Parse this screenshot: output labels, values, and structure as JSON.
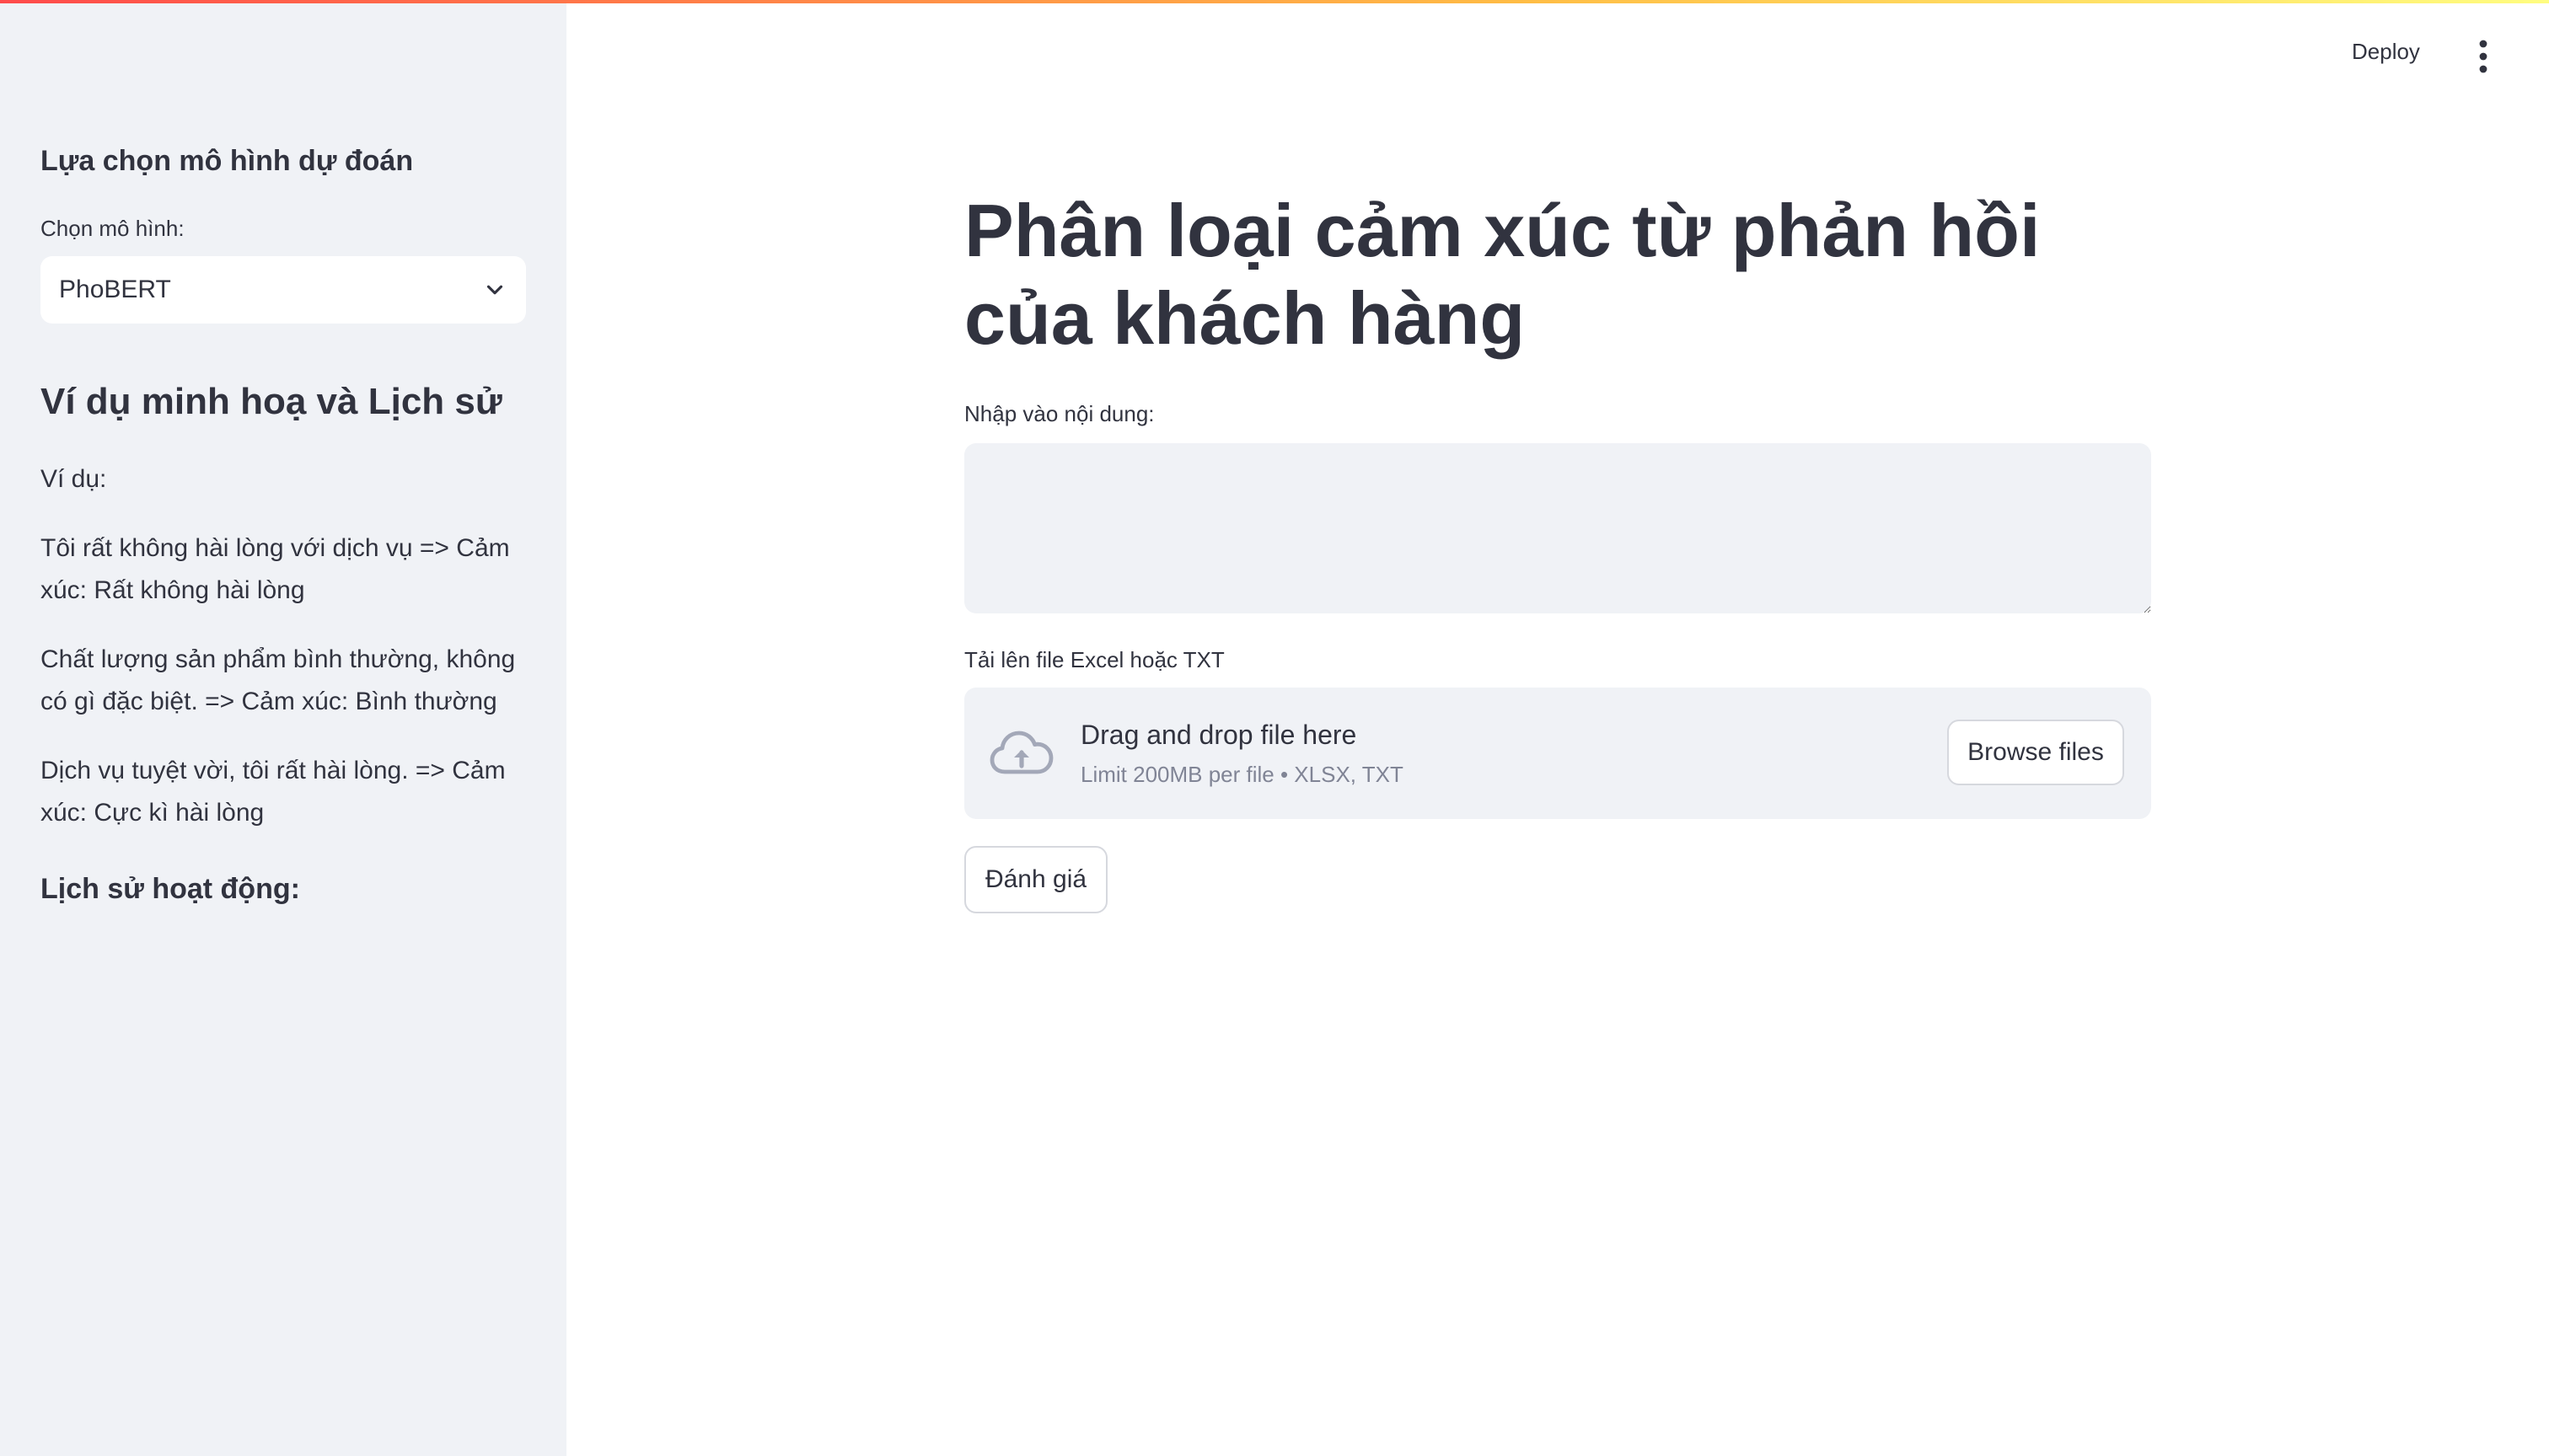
{
  "header": {
    "deploy_label": "Deploy",
    "menu_icon": "kebab-menu-icon"
  },
  "sidebar": {
    "model_heading": "Lựa chọn mô hình dự đoán",
    "select_label": "Chọn mô hình:",
    "select_value": "PhoBERT",
    "examples_heading": "Ví dụ minh hoạ và Lịch sử",
    "examples_label": "Ví dụ:",
    "examples": [
      "Tôi rất không hài lòng với dịch vụ => Cảm xúc: Rất không hài lòng",
      "Chất lượng sản phẩm bình thường, không có gì đặc biệt. => Cảm xúc: Bình thường",
      "Dịch vụ tuyệt vời, tôi rất hài lòng. => Cảm xúc: Cực kì hài lòng"
    ],
    "history_heading": "Lịch sử hoạt động:"
  },
  "main": {
    "title": "Phân loại cảm xúc từ phản hồi của khách hàng",
    "input_label": "Nhập vào nội dung:",
    "input_value": "",
    "upload_label": "Tải lên file Excel hoặc TXT",
    "upload": {
      "drag_text": "Drag and drop file here",
      "limit_text": "Limit 200MB per file • XLSX, TXT",
      "browse_label": "Browse files",
      "icon": "cloud-upload-icon"
    },
    "evaluate_label": "Đánh giá"
  },
  "colors": {
    "sidebar_bg": "#f0f2f6",
    "text": "#31333f",
    "muted": "#808495",
    "gradient_start": "#ff4b4b",
    "gradient_end": "#fffd80"
  }
}
